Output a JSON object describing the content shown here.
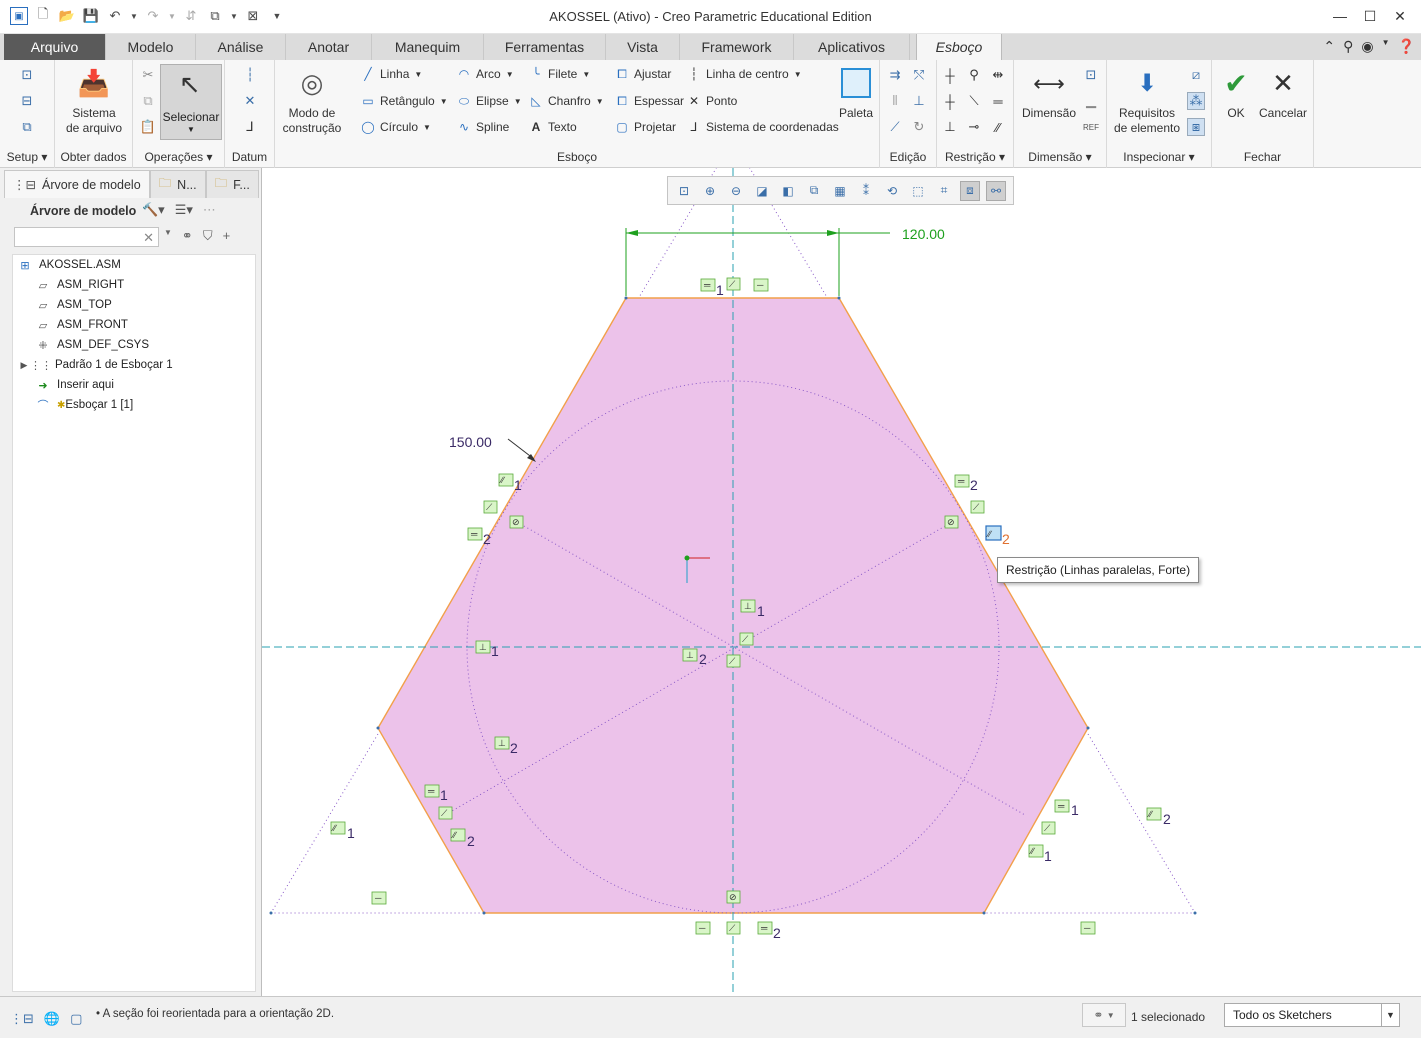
{
  "window": {
    "title": "AKOSSEL (Ativo) - Creo Parametric Educational Edition"
  },
  "tabs": [
    "Arquivo",
    "Modelo",
    "Análise",
    "Anotar",
    "Manequim",
    "Ferramentas",
    "Vista",
    "Framework",
    "Aplicativos",
    "Esboço"
  ],
  "ribbon": {
    "groups": {
      "setup": "Setup",
      "obter": "Obter dados",
      "operacoes": "Operações",
      "datum": "Datum",
      "esboco": "Esboço",
      "edicao": "Edição",
      "restricao": "Restrição",
      "dimensao": "Dimensão",
      "inspecionar": "Inspecionar",
      "fechar": "Fechar"
    },
    "buttons": {
      "sistema1": "Sistema",
      "sistema2": "de arquivo",
      "selecionar": "Selecionar",
      "modo1": "Modo de",
      "modo2": "construção",
      "linha": "Linha",
      "retangulo": "Retângulo",
      "circulo": "Círculo",
      "arco": "Arco",
      "elipse": "Elipse",
      "spline": "Spline",
      "filete": "Filete",
      "chanfro": "Chanfro",
      "texto": "Texto",
      "ajustar": "Ajustar",
      "espessar": "Espessar",
      "projetar": "Projetar",
      "linha_centro": "Linha de centro",
      "ponto": "Ponto",
      "sistema_coord": "Sistema de coordenadas",
      "paleta": "Paleta",
      "dimensao": "Dimensão",
      "requisitos1": "Requisitos",
      "requisitos2": "de elemento",
      "ok": "OK",
      "cancelar": "Cancelar"
    }
  },
  "left_panel": {
    "tabs": [
      "Árvore de modelo",
      "N...",
      "F..."
    ],
    "tree_title": "Árvore de modelo",
    "items": [
      "AKOSSEL.ASM",
      "ASM_RIGHT",
      "ASM_TOP",
      "ASM_FRONT",
      "ASM_DEF_CSYS",
      "Padrão 1 de Esboçar 1",
      "Inserir aqui",
      "Esboçar 1 [1]"
    ]
  },
  "sketch": {
    "dim_top": "120.00",
    "dim_left": "150.00",
    "labels": {
      "top_eq": "1",
      "par_l1": "1",
      "eq_l2": "2",
      "eq_r2": "2",
      "par_r2": "2",
      "perp_c1": "1",
      "perp_l1": "1",
      "perp_c2": "2",
      "perp_l2": "2",
      "eq_ll1": "1",
      "par_ll2": "2",
      "par_far_l1": "1",
      "eq_lr1": "1",
      "par_lr1": "1",
      "par_far_r2": "2",
      "eq_bot2": "2"
    },
    "fill_color": "#ecc2ea",
    "edge_color": "#f2a04a",
    "centerline_color": "#2aa0b0",
    "dim_color": "#1ea01e"
  },
  "tooltip": "Restrição (Linhas paralelas, Forte)",
  "status": {
    "message": "A seção foi reorientada para a orientação 2D.",
    "selected": "1 selecionado",
    "filter": "Todo os Sketchers"
  }
}
